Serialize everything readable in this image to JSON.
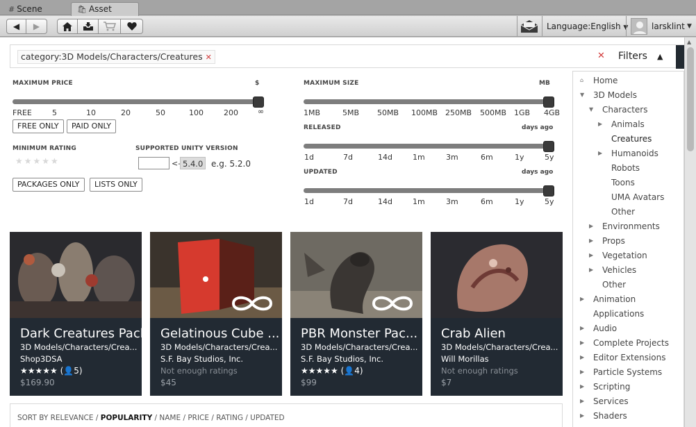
{
  "tabs": [
    {
      "label": "Scene"
    },
    {
      "label": "Asset Store"
    }
  ],
  "toolbar": {
    "language": "Language:English",
    "username": "larsklint"
  },
  "search": {
    "chip": "category:3D Models/Characters/Creatures",
    "filters_label": "Filters"
  },
  "filters": {
    "max_price_label": "MAXIMUM PRICE",
    "max_price_unit": "$",
    "price_ticks": [
      "FREE",
      "5",
      "10",
      "20",
      "50",
      "100",
      "200",
      "∞"
    ],
    "free_only": "FREE ONLY",
    "paid_only": "PAID ONLY",
    "min_rating_label": "MINIMUM RATING",
    "unity_version_label": "SUPPORTED UNITY VERSION",
    "version_arrow": "<-",
    "version_current": "5.4.0",
    "version_hint": "e.g. 5.2.0",
    "packages_only": "PACKAGES ONLY",
    "lists_only": "LISTS ONLY",
    "max_size_label": "MAXIMUM SIZE",
    "max_size_unit": "MB",
    "size_ticks": [
      "1MB",
      "5MB",
      "50MB",
      "100MB",
      "250MB",
      "500MB",
      "1GB",
      "4GB"
    ],
    "released_label": "RELEASED",
    "released_unit": "days ago",
    "released_ticks": [
      "1d",
      "7d",
      "14d",
      "1m",
      "3m",
      "6m",
      "1y",
      "5y"
    ],
    "updated_label": "UPDATED",
    "updated_unit": "days ago",
    "updated_ticks": [
      "1d",
      "7d",
      "14d",
      "1m",
      "3m",
      "6m",
      "1y",
      "5y"
    ]
  },
  "cards": [
    {
      "title": "Dark Creatures Pack",
      "category": "3D Models/Characters/Crea...",
      "publisher": "Shop3DSA",
      "stars": "★★★★★",
      "rating_count": "(👤5)",
      "price": "$169.90"
    },
    {
      "title": "Gelatinous Cube ...",
      "category": "3D Models/Characters/Crea...",
      "publisher": "S.F. Bay Studios, Inc.",
      "rating_text": "Not enough ratings",
      "price": "$45"
    },
    {
      "title": "PBR Monster Pac...",
      "category": "3D Models/Characters/Crea...",
      "publisher": "S.F. Bay Studios, Inc.",
      "stars": "★★★★★",
      "rating_count": "(👤4)",
      "price": "$99"
    },
    {
      "title": "Crab Alien",
      "category": "3D Models/Characters/Crea...",
      "publisher": "Will Morillas",
      "rating_text": "Not enough ratings",
      "price": "$7"
    }
  ],
  "sort": {
    "prefix": "SORT BY RELEVANCE / ",
    "active": "POPULARITY",
    "rest": " / NAME / PRICE / RATING / UPDATED"
  },
  "sidebar": {
    "items": [
      {
        "label": "Home"
      },
      {
        "label": "3D Models"
      },
      {
        "label": "Characters"
      },
      {
        "label": "Animals"
      },
      {
        "label": "Creatures"
      },
      {
        "label": "Humanoids"
      },
      {
        "label": "Robots"
      },
      {
        "label": "Toons"
      },
      {
        "label": "UMA Avatars"
      },
      {
        "label": "Other"
      },
      {
        "label": "Environments"
      },
      {
        "label": "Props"
      },
      {
        "label": "Vegetation"
      },
      {
        "label": "Vehicles"
      },
      {
        "label": "Other"
      },
      {
        "label": "Animation"
      },
      {
        "label": "Applications"
      },
      {
        "label": "Audio"
      },
      {
        "label": "Complete Projects"
      },
      {
        "label": "Editor Extensions"
      },
      {
        "label": "Particle Systems"
      },
      {
        "label": "Scripting"
      },
      {
        "label": "Services"
      },
      {
        "label": "Shaders"
      }
    ]
  },
  "colors": {
    "card_bg": "#222a33",
    "remove_red": "#d23b3b"
  }
}
